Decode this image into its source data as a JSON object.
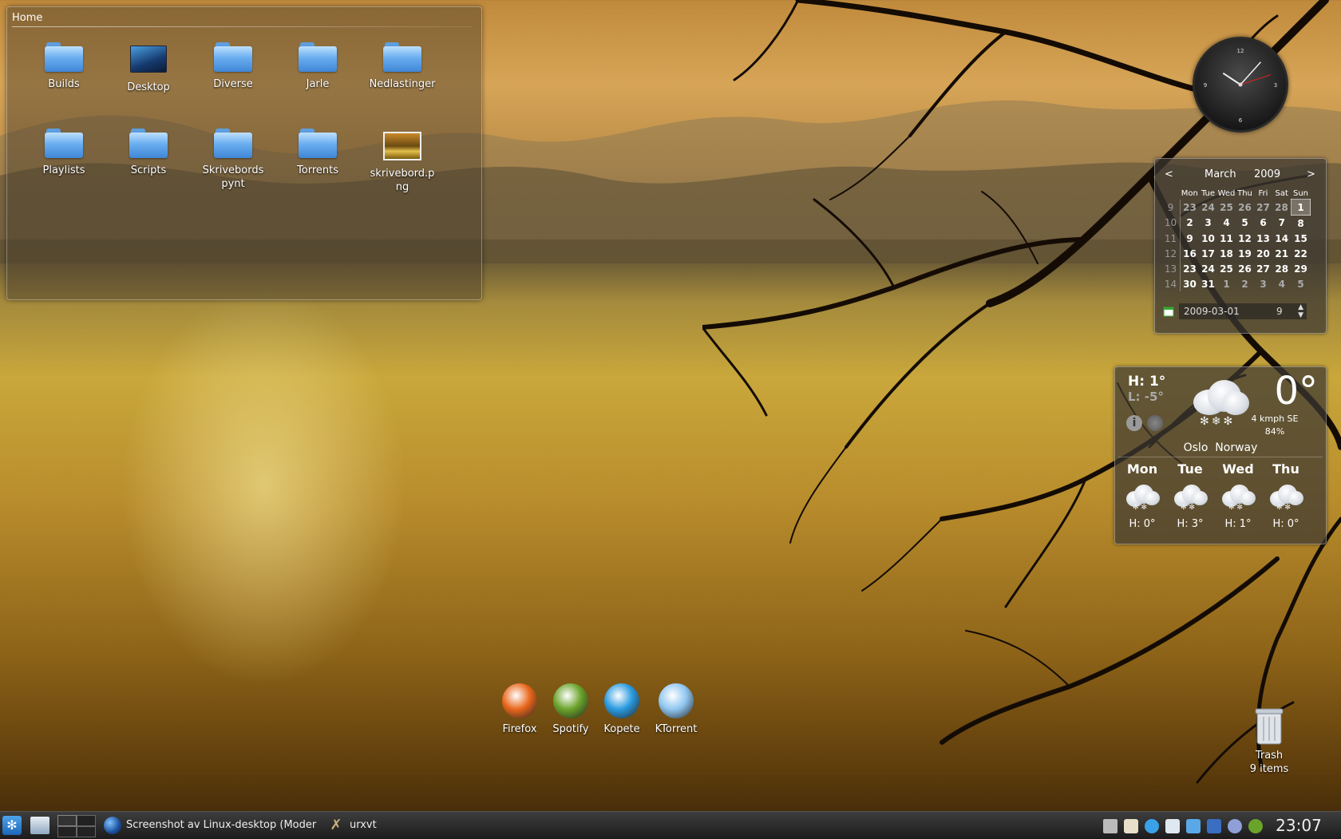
{
  "folderview": {
    "title": "Home",
    "items": [
      {
        "label": "Builds",
        "type": "folder"
      },
      {
        "label": "Desktop",
        "type": "desktop"
      },
      {
        "label": "Diverse",
        "type": "folder"
      },
      {
        "label": "Jarle",
        "type": "folder"
      },
      {
        "label": "Nedlastinger",
        "type": "folder"
      },
      {
        "label": "Playlists",
        "type": "folder"
      },
      {
        "label": "Scripts",
        "type": "folder"
      },
      {
        "label": "Skrivebords pynt",
        "type": "folder"
      },
      {
        "label": "Torrents",
        "type": "folder"
      },
      {
        "label": "skrivebord.p ng",
        "type": "image"
      }
    ]
  },
  "clock": {
    "hour": 10,
    "minute": 7,
    "second": 12,
    "icon": "analog-clock-icon"
  },
  "calendar": {
    "prev": "<",
    "next": ">",
    "month": "March",
    "year": "2009",
    "day_headers": [
      "Mon",
      "Tue",
      "Wed",
      "Thu",
      "Fri",
      "Sat",
      "Sun"
    ],
    "weeks": [
      {
        "week": "9",
        "days": [
          "23",
          "24",
          "25",
          "26",
          "27",
          "28",
          "1"
        ],
        "dim": [
          true,
          true,
          true,
          true,
          true,
          true,
          false
        ],
        "selected": 6
      },
      {
        "week": "10",
        "days": [
          "2",
          "3",
          "4",
          "5",
          "6",
          "7",
          "8"
        ],
        "dim": [
          false,
          false,
          false,
          false,
          false,
          false,
          false
        ]
      },
      {
        "week": "11",
        "days": [
          "9",
          "10",
          "11",
          "12",
          "13",
          "14",
          "15"
        ],
        "dim": [
          false,
          false,
          false,
          false,
          false,
          false,
          false
        ]
      },
      {
        "week": "12",
        "days": [
          "16",
          "17",
          "18",
          "19",
          "20",
          "21",
          "22"
        ],
        "dim": [
          false,
          false,
          false,
          false,
          false,
          false,
          false
        ]
      },
      {
        "week": "13",
        "days": [
          "23",
          "24",
          "25",
          "26",
          "27",
          "28",
          "29"
        ],
        "dim": [
          false,
          false,
          false,
          false,
          false,
          false,
          false
        ]
      },
      {
        "week": "14",
        "days": [
          "30",
          "31",
          "1",
          "2",
          "3",
          "4",
          "5"
        ],
        "dim": [
          false,
          false,
          true,
          true,
          true,
          true,
          true
        ]
      }
    ],
    "date_value": "2009-03-01",
    "week_value": "9"
  },
  "weather": {
    "high": "H: 1°",
    "low": "L: -5°",
    "temp": "0°",
    "wind": "4 kmph SE",
    "humidity": "84%",
    "location": "Oslo  Norway",
    "forecast": [
      {
        "day": "Mon",
        "high": "H: 0°"
      },
      {
        "day": "Tue",
        "high": "H: 3°"
      },
      {
        "day": "Wed",
        "high": "H: 1°"
      },
      {
        "day": "Thu",
        "high": "H: 0°"
      }
    ]
  },
  "launchers": [
    {
      "label": "Firefox",
      "icon": "firefox-icon",
      "color": "#e8661a"
    },
    {
      "label": "Spotify",
      "icon": "spotify-icon",
      "color": "#6aa32a"
    },
    {
      "label": "Kopete",
      "icon": "kopete-icon",
      "color": "#2a9ae0"
    },
    {
      "label": "KTorrent",
      "icon": "ktorrent-icon",
      "color": "#8fc6f0"
    }
  ],
  "trash": {
    "label": "Trash",
    "count": "9 items"
  },
  "taskbar": {
    "tasks": [
      {
        "label": "Screenshot av Linux-desktop (Moder",
        "icon": "globe-icon"
      },
      {
        "label": "urxvt",
        "icon": "terminal-icon"
      }
    ],
    "clock": "23:07"
  }
}
